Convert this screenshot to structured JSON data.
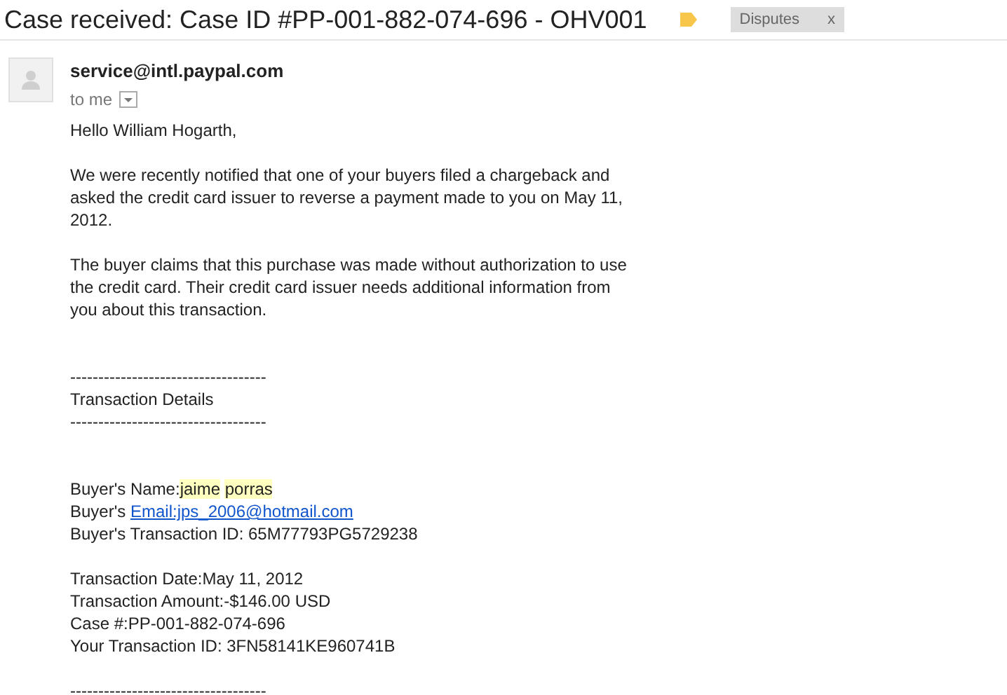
{
  "subject": "Case received: Case ID #PP-001-882-074-696 - OHV001",
  "label": {
    "text": "Disputes",
    "close": "x"
  },
  "sender": {
    "email": "service@intl.paypal.com",
    "recipient": "to me"
  },
  "blocks": [
    {
      "kind": "greeting",
      "lines": [
        [
          {
            "kind": "plain",
            "text": "Hello William Hogarth,"
          }
        ]
      ]
    },
    {
      "kind": "paragraph",
      "lines": [
        [
          {
            "kind": "plain",
            "text": "We were recently notified that one of your buyers filed a chargeback and"
          }
        ],
        [
          {
            "kind": "plain",
            "text": "asked the credit card issuer to reverse a payment made to you on May 11,"
          }
        ],
        [
          {
            "kind": "plain",
            "text": "2012."
          }
        ]
      ]
    },
    {
      "kind": "paragraph",
      "lines": [
        [
          {
            "kind": "plain",
            "text": "The buyer claims that this purchase was made without authorization to use"
          }
        ],
        [
          {
            "kind": "plain",
            "text": "the credit card. Their credit card issuer needs additional information from"
          }
        ],
        [
          {
            "kind": "plain",
            "text": "you about this transaction."
          }
        ]
      ]
    },
    {
      "kind": "heading",
      "lines": [
        [
          {
            "kind": "plain",
            "text": "-----------------------------------"
          }
        ],
        [
          {
            "kind": "plain",
            "text": "Transaction Details"
          }
        ],
        [
          {
            "kind": "plain",
            "text": "-----------------------------------"
          }
        ]
      ]
    },
    {
      "kind": "buyer",
      "lines": [
        [
          {
            "kind": "plain",
            "text": "Buyer's Name:"
          },
          {
            "kind": "highlight",
            "text": "jaime"
          },
          {
            "kind": "highlight",
            "text": "porras"
          }
        ],
        [
          {
            "kind": "plain",
            "text": "Buyer's "
          },
          {
            "kind": "link",
            "text": "Email:jps_2006@hotmail.com"
          }
        ],
        [
          {
            "kind": "plain",
            "text": "Buyer's Transaction ID: 65M77793PG5729238"
          }
        ]
      ]
    },
    {
      "kind": "transaction",
      "lines": [
        [
          {
            "kind": "plain",
            "text": "Transaction Date:May 11, 2012"
          }
        ],
        [
          {
            "kind": "plain",
            "text": "Transaction Amount:-$146.00 USD"
          }
        ],
        [
          {
            "kind": "plain",
            "text": "Case #:PP-001-882-074-696"
          }
        ],
        [
          {
            "kind": "plain",
            "text": "Your Transaction ID: 3FN58141KE960741B"
          }
        ]
      ]
    },
    {
      "kind": "rule",
      "lines": [
        [
          {
            "kind": "plain",
            "text": "-----------------------------------"
          }
        ]
      ]
    }
  ]
}
